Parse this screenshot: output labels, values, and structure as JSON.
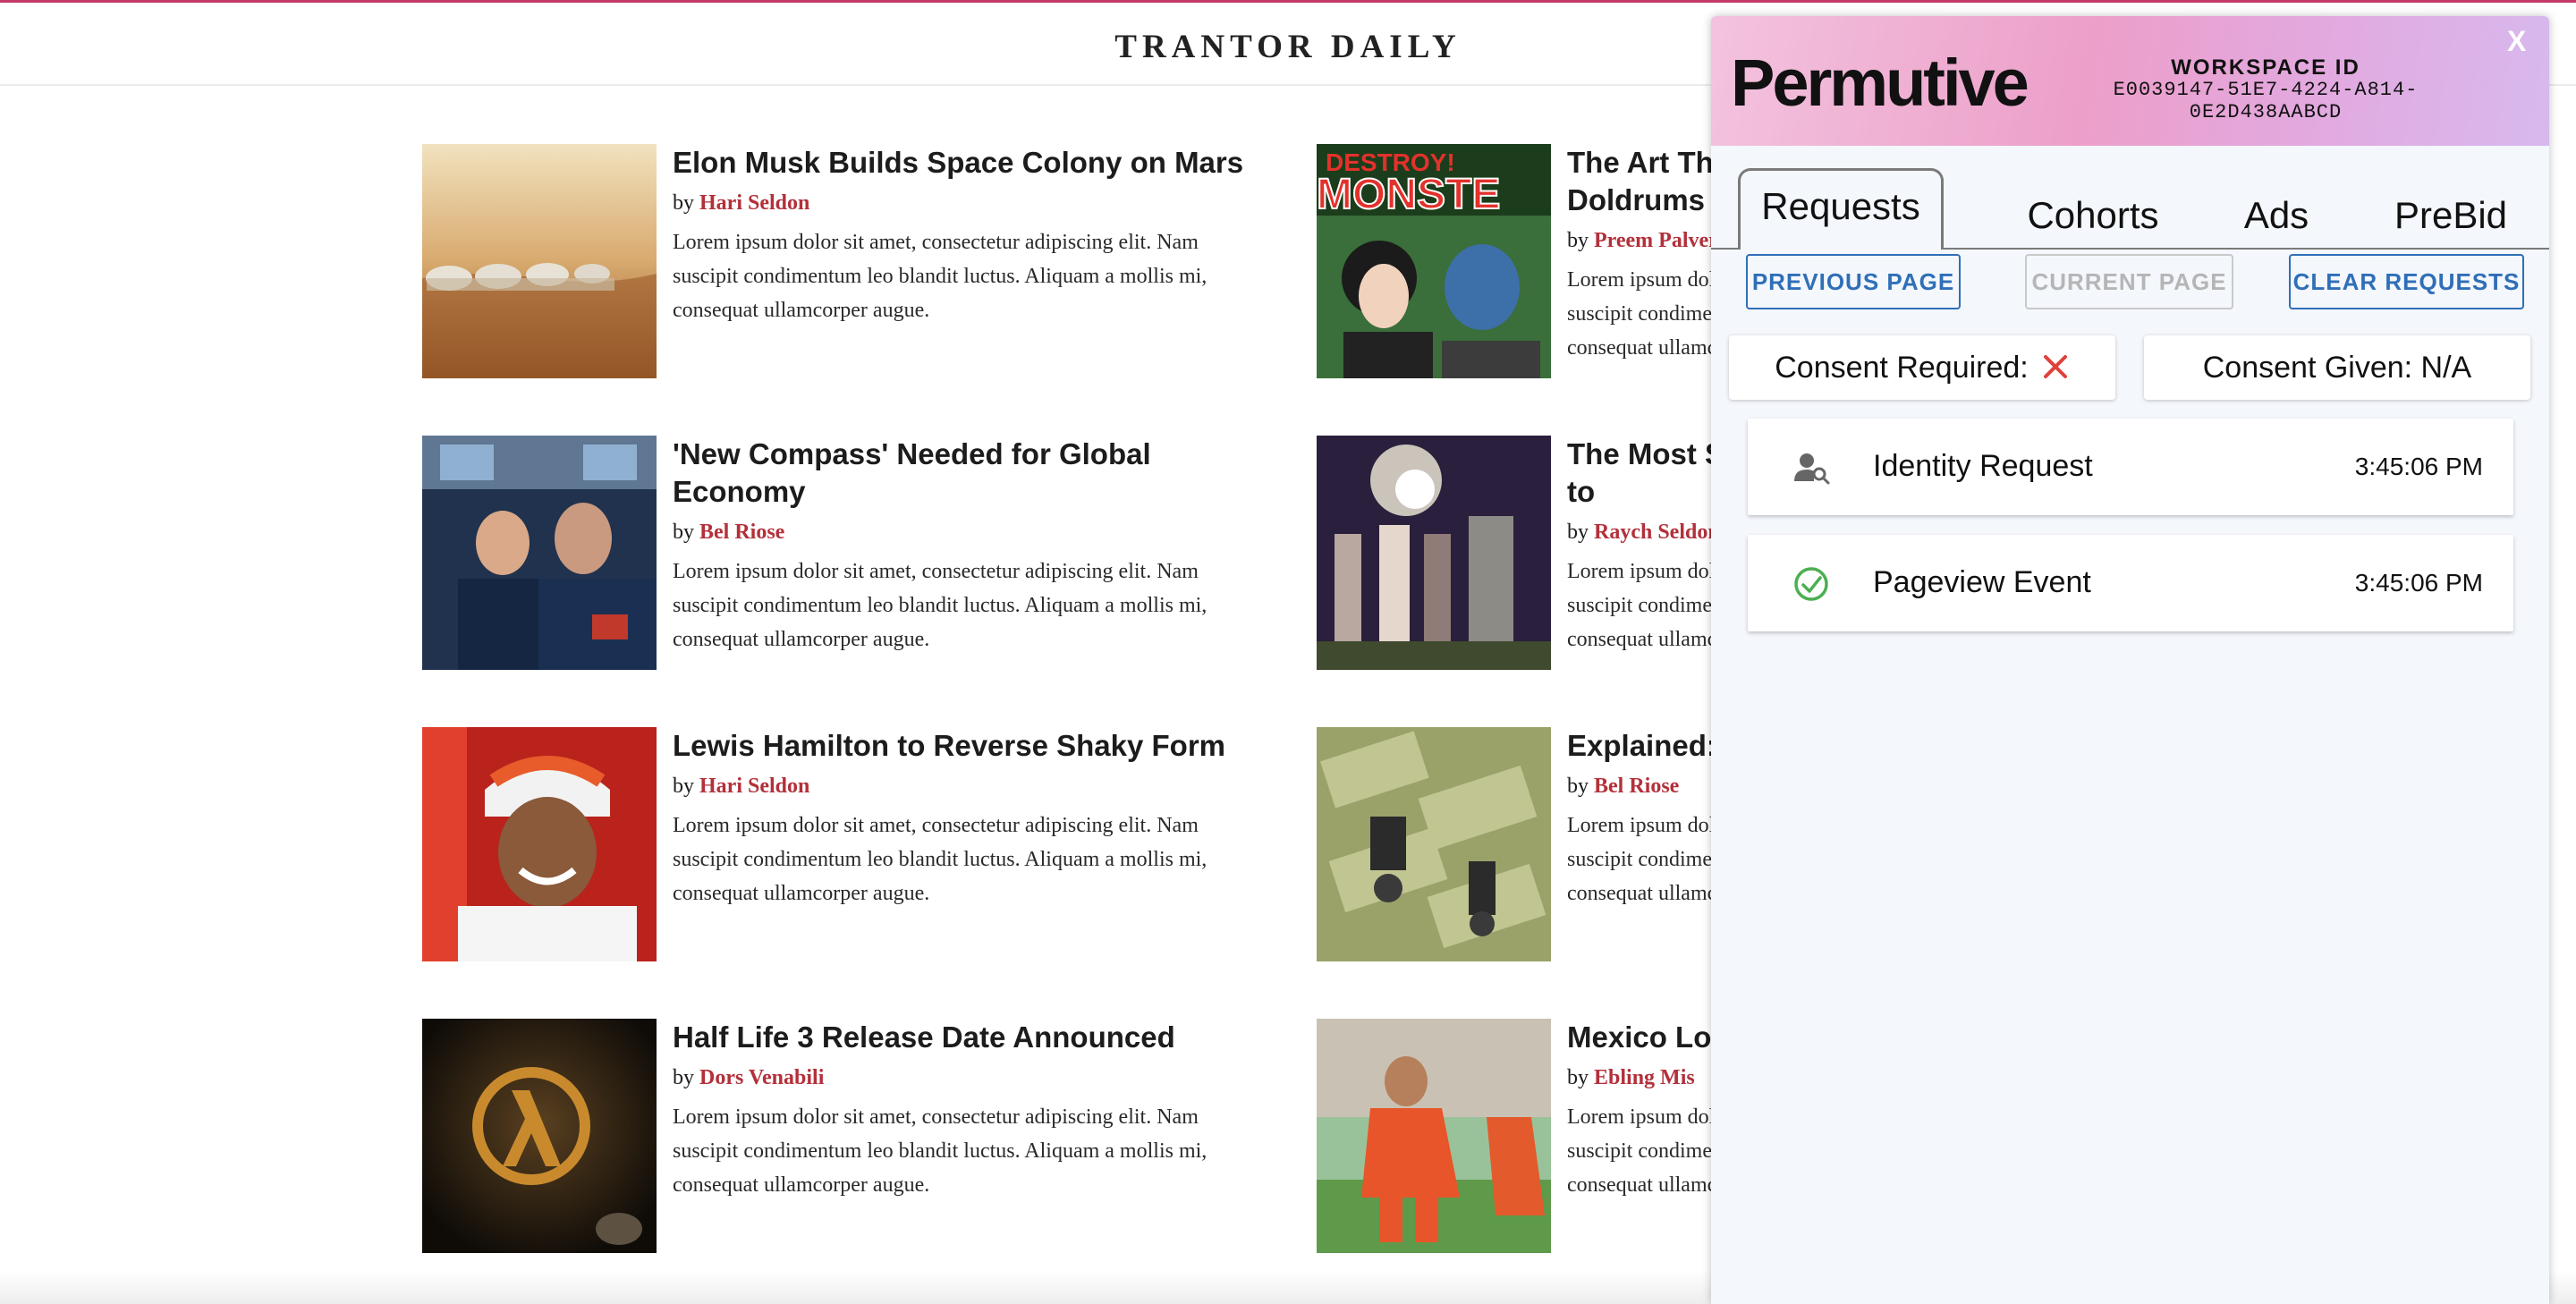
{
  "site": {
    "title": "TRANTOR DAILY"
  },
  "articles": [
    {
      "headline": "Elon Musk Builds Space Colony on Mars",
      "by": "by",
      "author": "Hari Seldon",
      "summary": "Lorem ipsum dolor sit amet, consectetur adipiscing elit. Nam suscipit condimentum leo blandit luctus. Aliquam a mollis mi, consequat ullamcorper augue."
    },
    {
      "headline": "The Art That Is Lifting Us Out Of Our Doldrums",
      "by": "by",
      "author": "Preem Palver",
      "summary": "Lorem ipsum dolor sit amet, consectetur adipiscing elit. Nam suscipit condimentum leo blandit luctus. Aliquam a mollis mi, consequat ullamcorper augue."
    },
    {
      "headline": "'New Compass' Needed for Global Economy",
      "by": "by",
      "author": "Bel Riose",
      "summary": "Lorem ipsum dolor sit amet, consectetur adipiscing elit. Nam suscipit condimentum leo blandit luctus. Aliquam a mollis mi, consequat ullamcorper augue."
    },
    {
      "headline": "The Most Spectacular Festivals Thanks to",
      "by": "by",
      "author": "Raych Seldon",
      "summary": "Lorem ipsum dolor sit amet, consectetur adipiscing elit. Nam suscipit condimentum leo blandit luctus. Aliquam a mollis mi, consequat ullamcorper augue."
    },
    {
      "headline": "Lewis Hamilton to Reverse Shaky Form",
      "by": "by",
      "author": "Hari Seldon",
      "summary": "Lorem ipsum dolor sit amet, consectetur adipiscing elit. Nam suscipit condimentum leo blandit luctus. Aliquam a mollis mi, consequat ullamcorper augue."
    },
    {
      "headline": "Explained:",
      "by": "by",
      "author": "Bel Riose",
      "summary": "Lorem ipsum dolor sit amet, consectetur adipiscing elit. Nam suscipit condimentum leo blandit luctus. Aliquam a mollis mi, consequat ullamcorper augue."
    },
    {
      "headline": "Half Life 3 Release Date Announced",
      "by": "by",
      "author": "Dors Venabili",
      "summary": "Lorem ipsum dolor sit amet, consectetur adipiscing elit. Nam suscipit condimentum leo blandit luctus. Aliquam a mollis mi, consequat ullamcorper augue."
    },
    {
      "headline": "Mexico Lose to Netherlands",
      "by": "by",
      "author": "Ebling Mis",
      "summary": "Lorem ipsum dolor sit amet, consectetur adipiscing elit. Nam suscipit condimentum leo blandit luctus. Aliquam a mollis mi, consequat ullamcorper augue."
    }
  ],
  "panel": {
    "logo": "Permutive",
    "workspace_label": "WORKSPACE ID",
    "workspace_id": "E0039147-51E7-4224-A814-0E2D438AABCD",
    "close_label": "X",
    "tabs": [
      "Requests",
      "Cohorts",
      "Ads",
      "PreBid"
    ],
    "active_tab": "Requests",
    "buttons": {
      "previous": "PREVIOUS PAGE",
      "current": "CURRENT PAGE",
      "clear": "CLEAR REQUESTS"
    },
    "consent_required": "Consent Required:",
    "consent_required_icon": "close-icon",
    "consent_given": "Consent Given: N/A",
    "requests": [
      {
        "name": "Identity Request",
        "time": "3:45:06 PM",
        "icon": "person-search-icon"
      },
      {
        "name": "Pageview Event",
        "time": "3:45:06 PM",
        "icon": "check-circle-icon"
      }
    ],
    "colors": {
      "accent": "#2f6fb7",
      "author": "#b3303a",
      "error": "#e0413a",
      "success": "#4caf50"
    }
  }
}
